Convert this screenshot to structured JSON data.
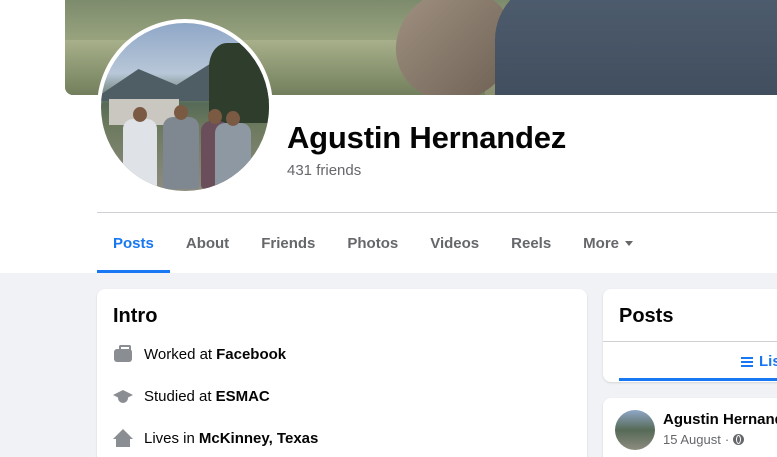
{
  "profile": {
    "name": "Agustin Hernandez",
    "friends_count": "431 friends"
  },
  "tabs": [
    {
      "label": "Posts",
      "active": true
    },
    {
      "label": "About"
    },
    {
      "label": "Friends"
    },
    {
      "label": "Photos"
    },
    {
      "label": "Videos"
    },
    {
      "label": "Reels"
    },
    {
      "label": "More"
    }
  ],
  "intro": {
    "title": "Intro",
    "items": [
      {
        "icon": "briefcase-icon",
        "prefix": "Worked at",
        "value": "Facebook"
      },
      {
        "icon": "graduation-cap-icon",
        "prefix": "Studied at",
        "value": "ESMAC"
      },
      {
        "icon": "home-icon",
        "prefix": "Lives in",
        "value": "McKinney, Texas"
      }
    ]
  },
  "posts_panel": {
    "title": "Posts",
    "view_label": "List vie"
  },
  "post": {
    "author": "Agustin Hernand",
    "date": "15 August",
    "separator": "·"
  },
  "colors": {
    "accent": "#1877f2",
    "secondary_text": "#65676b",
    "page_bg": "#f0f2f5"
  }
}
